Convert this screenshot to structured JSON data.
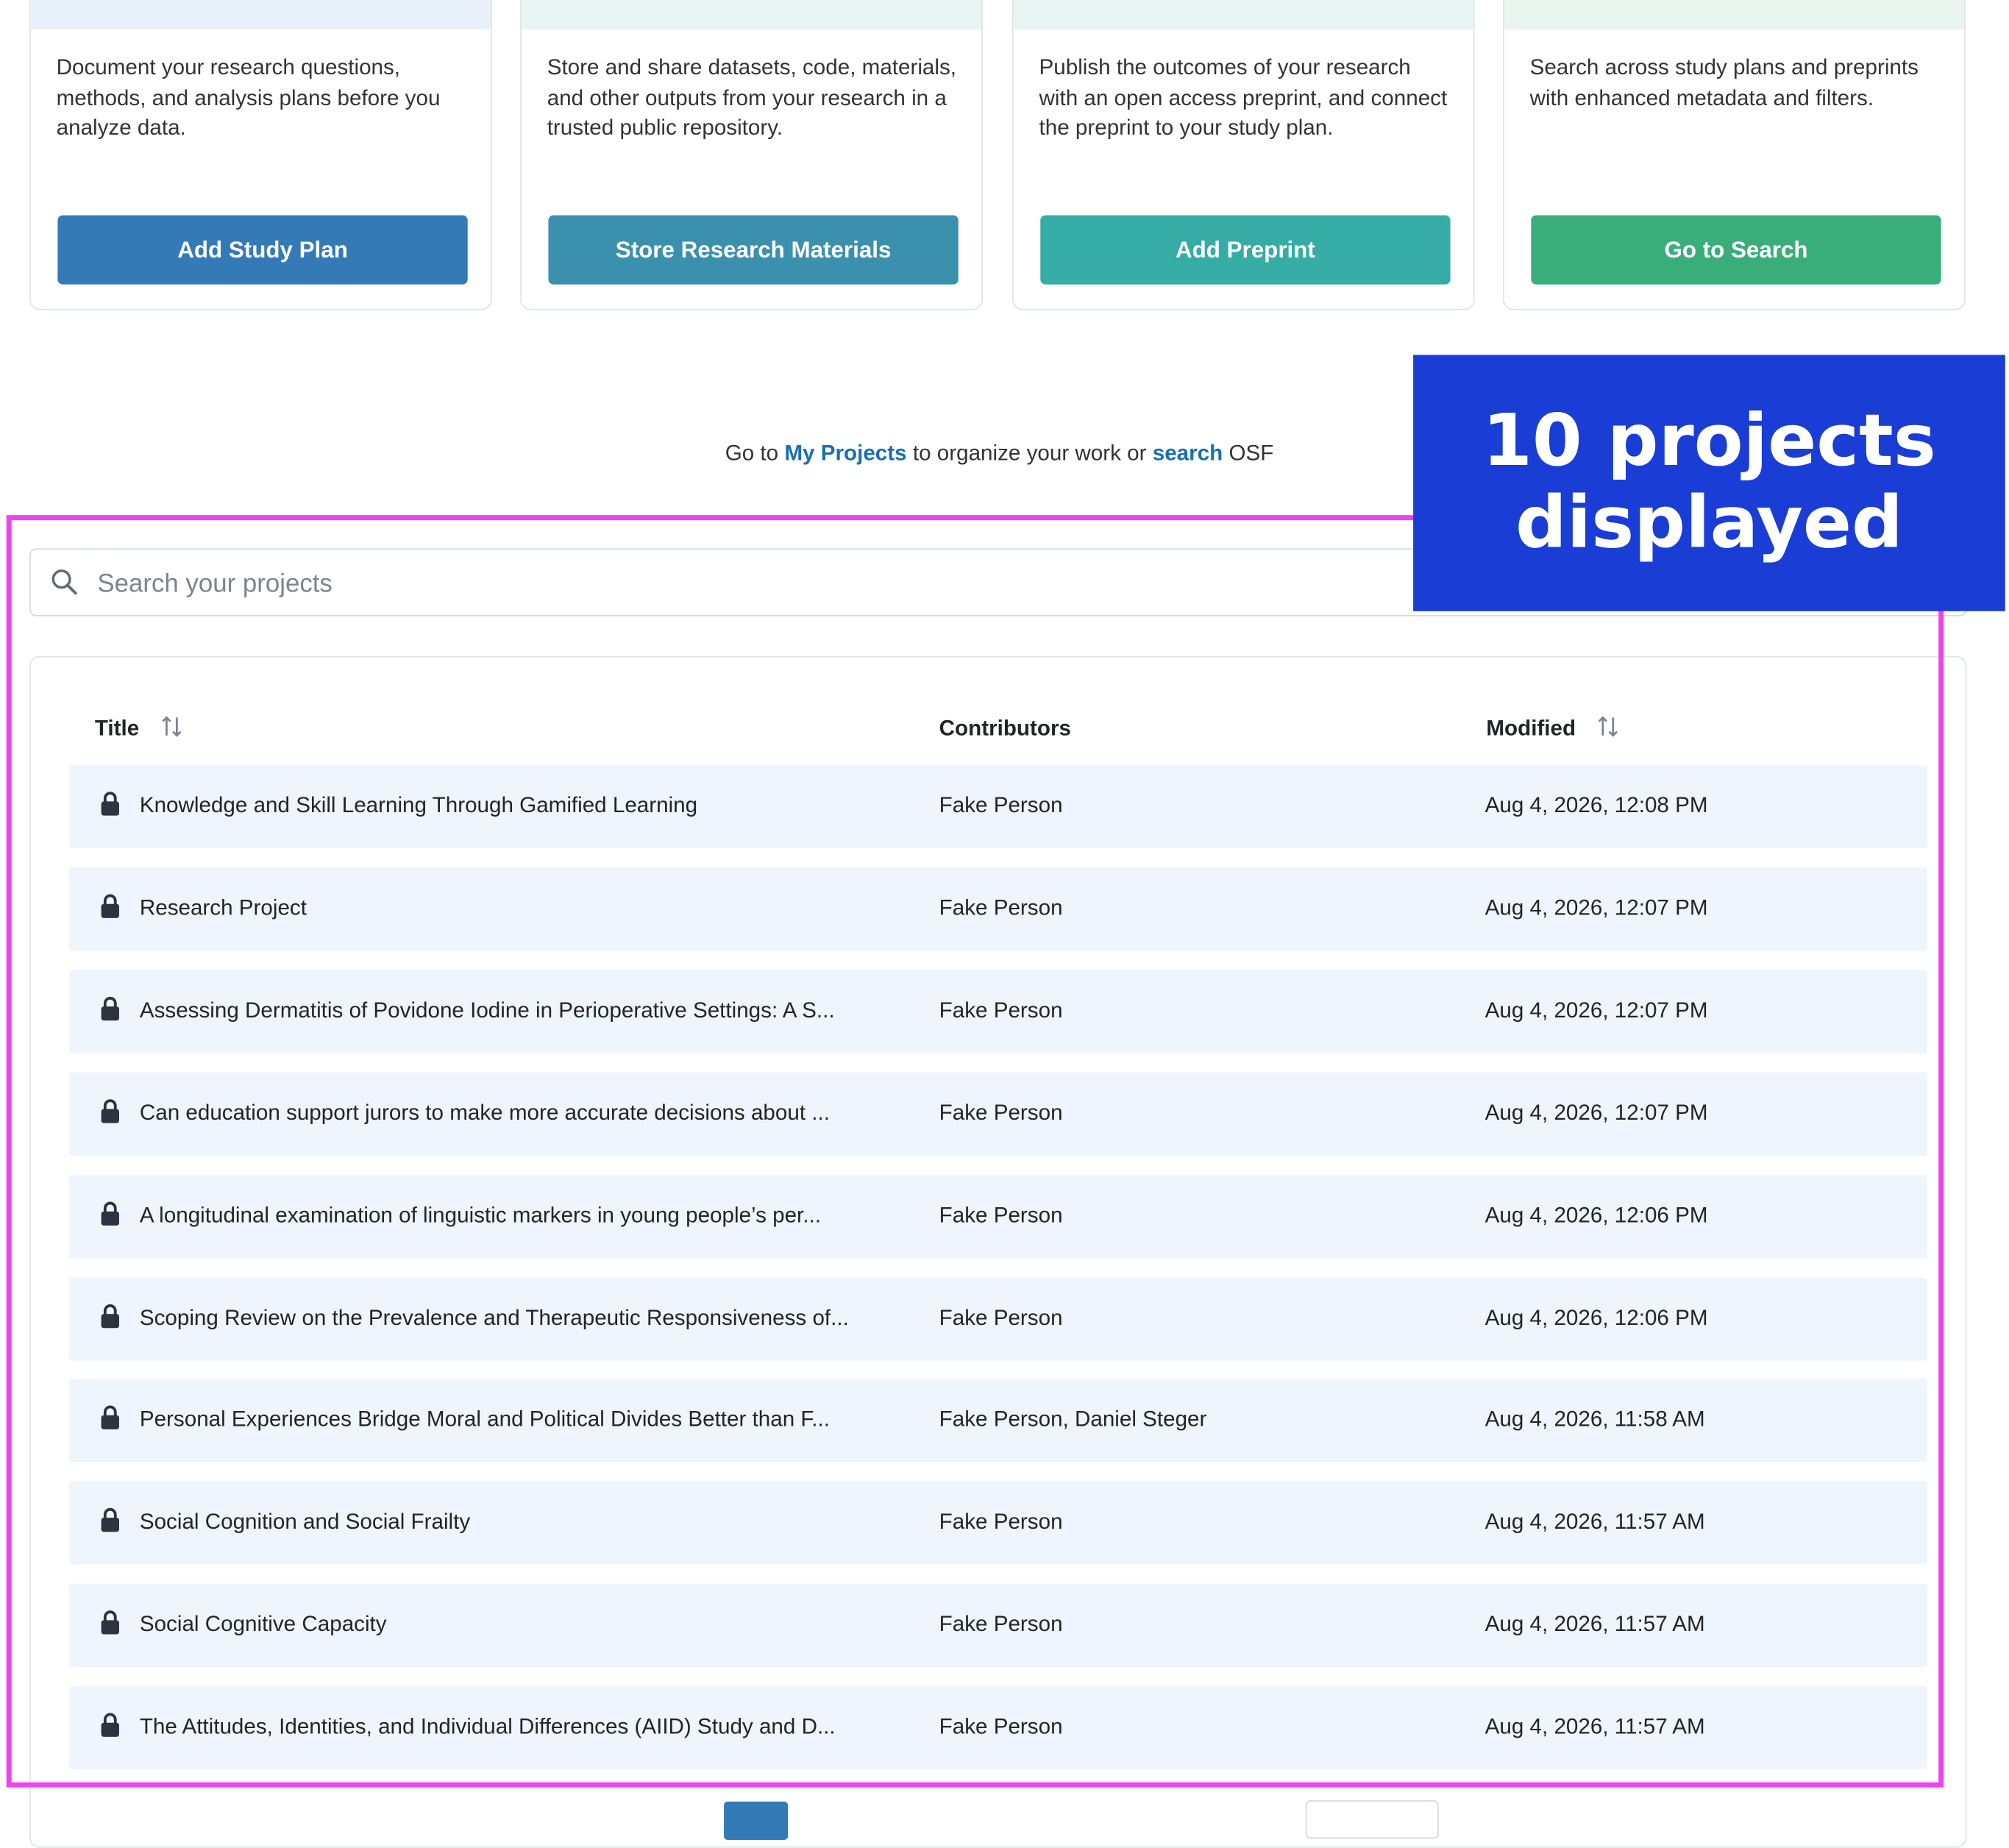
{
  "cards": [
    {
      "description": "Document your research questions, methods, and analysis plans before you analyze data.",
      "button_label": "Add Study Plan",
      "button_color": "#337ab7",
      "header_color": "#e8f1fa"
    },
    {
      "description": "Store and share datasets, code, materials, and other outputs from your research in a trusted public repository.",
      "button_label": "Store Research Materials",
      "button_color": "#3a90ad",
      "header_color": "#e9f4f5"
    },
    {
      "description": "Publish the outcomes of your research with an open access preprint, and connect the preprint to your study plan.",
      "button_label": "Add Preprint",
      "button_color": "#35aca6",
      "header_color": "#e8f5f3"
    },
    {
      "description": "Search across study plans and preprints with enhanced metadata and filters.",
      "button_label": "Go to Search",
      "button_color": "#3aae7a",
      "header_color": "#e8f6ef"
    }
  ],
  "goto": {
    "prefix": "Go to",
    "my_projects": "My Projects",
    "middle": "to organize your work or",
    "search": "search",
    "suffix": "OSF"
  },
  "search": {
    "placeholder": "Search your projects"
  },
  "table": {
    "headers": {
      "title": "Title",
      "contributors": "Contributors",
      "modified": "Modified"
    },
    "rows": [
      {
        "title": "Knowledge and Skill Learning Through Gamified Learning",
        "contributors": "Fake Person",
        "modified": "Aug 4, 2026, 12:08 PM"
      },
      {
        "title": "Research Project",
        "contributors": "Fake Person",
        "modified": "Aug 4, 2026, 12:07 PM"
      },
      {
        "title": "Assessing Dermatitis of Povidone Iodine in Perioperative Settings: A S...",
        "contributors": "Fake Person",
        "modified": "Aug 4, 2026, 12:07 PM"
      },
      {
        "title": "Can education support jurors to make more accurate decisions about ...",
        "contributors": "Fake Person",
        "modified": "Aug 4, 2026, 12:07 PM"
      },
      {
        "title": "A longitudinal examination of linguistic markers in young people’s per...",
        "contributors": "Fake Person",
        "modified": "Aug 4, 2026, 12:06 PM"
      },
      {
        "title": "Scoping Review on the Prevalence and Therapeutic Responsiveness of...",
        "contributors": "Fake Person",
        "modified": "Aug 4, 2026, 12:06 PM"
      },
      {
        "title": "Personal Experiences Bridge Moral and Political Divides Better than F...",
        "contributors": "Fake Person, Daniel Steger",
        "modified": "Aug 4, 2026, 11:58 AM"
      },
      {
        "title": "Social Cognition and Social Frailty",
        "contributors": "Fake Person",
        "modified": "Aug 4, 2026, 11:57 AM"
      },
      {
        "title": "Social Cognitive Capacity",
        "contributors": "Fake Person",
        "modified": "Aug 4, 2026, 11:57 AM"
      },
      {
        "title": "The Attitudes, Identities, and Individual Differences (AIID) Study and D...",
        "contributors": "Fake Person",
        "modified": "Aug 4, 2026, 11:57 AM"
      }
    ]
  },
  "annotation": {
    "line1": "10 projects",
    "line2": "displayed",
    "color": "#1a3dd6",
    "highlight_color": "#ee44ee"
  },
  "icons": {
    "search": "search-icon",
    "lock": "lock-icon",
    "sort": "sort-icon"
  }
}
